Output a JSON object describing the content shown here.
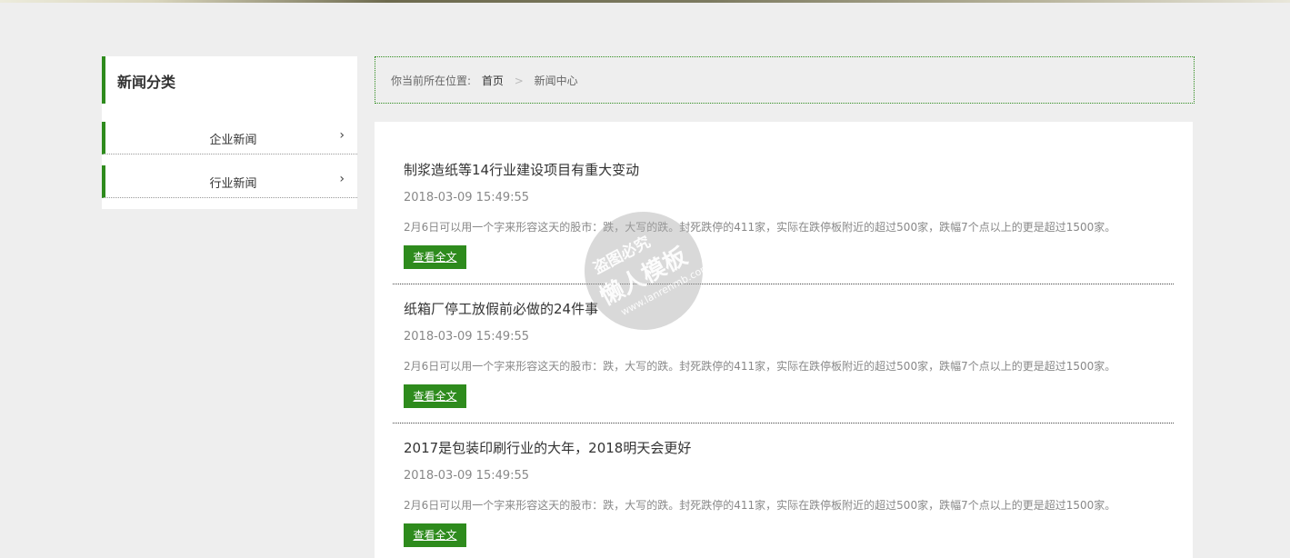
{
  "sidebar": {
    "title": "新闻分类",
    "items": [
      {
        "label": "企业新闻",
        "icon": "chevron-right-icon"
      },
      {
        "label": "行业新闻",
        "icon": "chevron-right-icon"
      }
    ]
  },
  "breadcrumb": {
    "prefix": "你当前所在位置:",
    "home": "首页",
    "separator": ">",
    "current": "新闻中心"
  },
  "articles": [
    {
      "title": "制浆造纸等14行业建设项目有重大变动",
      "date": "2018-03-09 15:49:55",
      "summary": "2月6日可以用一个字来形容这天的股市：跌，大写的跌。封死跌停的411家，实际在跌停板附近的超过500家，跌幅7个点以上的更是超过1500家。",
      "more": "查看全文"
    },
    {
      "title": "纸箱厂停工放假前必做的24件事",
      "date": "2018-03-09 15:49:55",
      "summary": "2月6日可以用一个字来形容这天的股市：跌，大写的跌。封死跌停的411家，实际在跌停板附近的超过500家，跌幅7个点以上的更是超过1500家。",
      "more": "查看全文"
    },
    {
      "title": "2017是包装印刷行业的大年，2018明天会更好",
      "date": "2018-03-09 15:49:55",
      "summary": "2月6日可以用一个字来形容这天的股市：跌，大写的跌。封死跌停的411家，实际在跌停板附近的超过500家，跌幅7个点以上的更是超过1500家。",
      "more": "查看全文"
    }
  ],
  "watermark": {
    "line1": "盗图必究",
    "line2": "懒人模板",
    "line3": "www.lanrenmb.com"
  },
  "colors": {
    "accent": "#2e8b1d",
    "background": "#eeeeee"
  }
}
